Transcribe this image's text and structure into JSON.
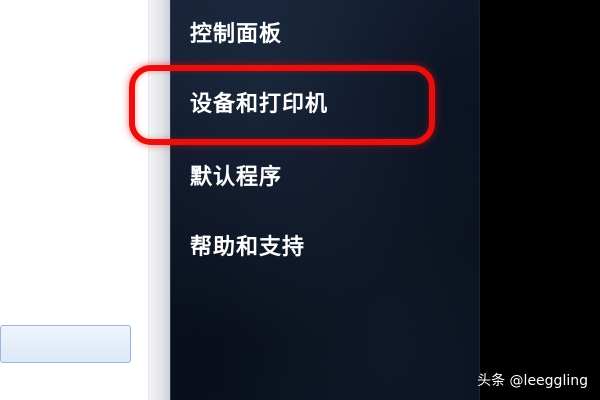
{
  "start_menu": {
    "items": [
      {
        "label": "控制面板"
      },
      {
        "label": "设备和打印机"
      },
      {
        "label": "默认程序"
      },
      {
        "label": "帮助和支持"
      }
    ],
    "highlighted_item": "设备和打印机",
    "highlight_color": "#e80f0f"
  },
  "watermark": {
    "text": "头条 @leeggling"
  }
}
